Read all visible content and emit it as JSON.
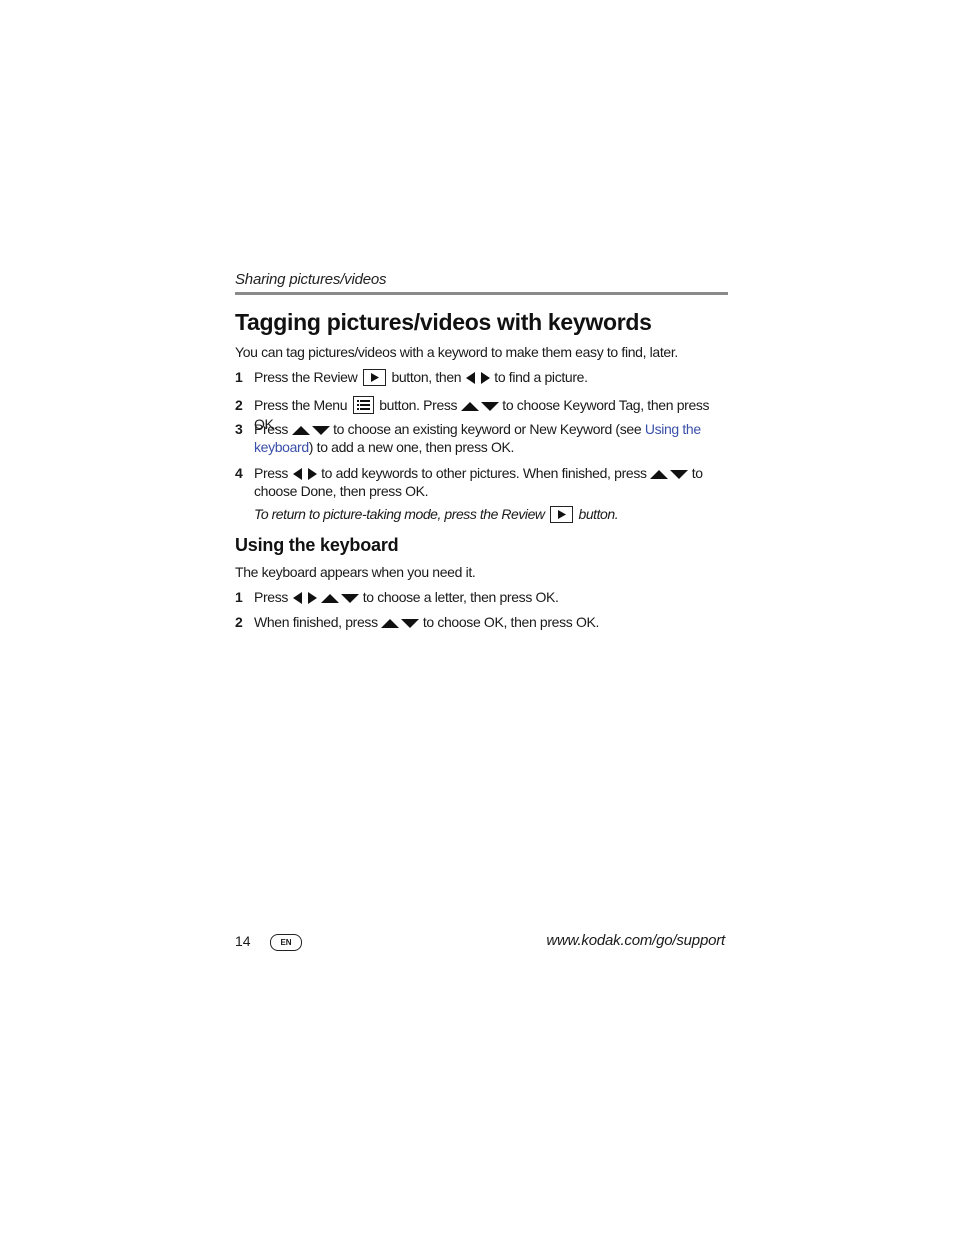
{
  "running_head": "Sharing pictures/videos",
  "title": "Tagging pictures/videos with keywords",
  "intro": "You can tag pictures/videos with a keyword to make them easy to find, later.",
  "steps": [
    {
      "num": "1",
      "a": "Press the Review",
      "b": "button, then",
      "c": "to find a picture."
    },
    {
      "num": "2",
      "a": "Press the Menu",
      "b": "button. Press",
      "c": "to choose Keyword Tag, then press OK."
    },
    {
      "num": "3",
      "a": "Press",
      "b": "to choose an existing keyword or New Keyword (see",
      "link": "Using the keyboard",
      "c": ") to add a new one, then press OK."
    },
    {
      "num": "4",
      "a": "Press",
      "b": "to add keywords to other pictures. When finished, press",
      "c": "to choose Done, then press OK."
    }
  ],
  "note": {
    "a": "To return to picture-taking mode, press the Review",
    "b": "button."
  },
  "section2": {
    "title": "Using the keyboard",
    "intro": "The keyboard appears when you need it.",
    "steps": [
      {
        "num": "1",
        "a": "Press",
        "b": "to choose a letter, then press OK."
      },
      {
        "num": "2",
        "a": "When finished, press",
        "b": "to choose OK, then press OK."
      }
    ]
  },
  "footer": {
    "page_number": "14",
    "language": "EN",
    "url": "www.kodak.com/go/support"
  },
  "colors": {
    "link": "#3a4fa8",
    "rule": "#8a8a8a"
  }
}
